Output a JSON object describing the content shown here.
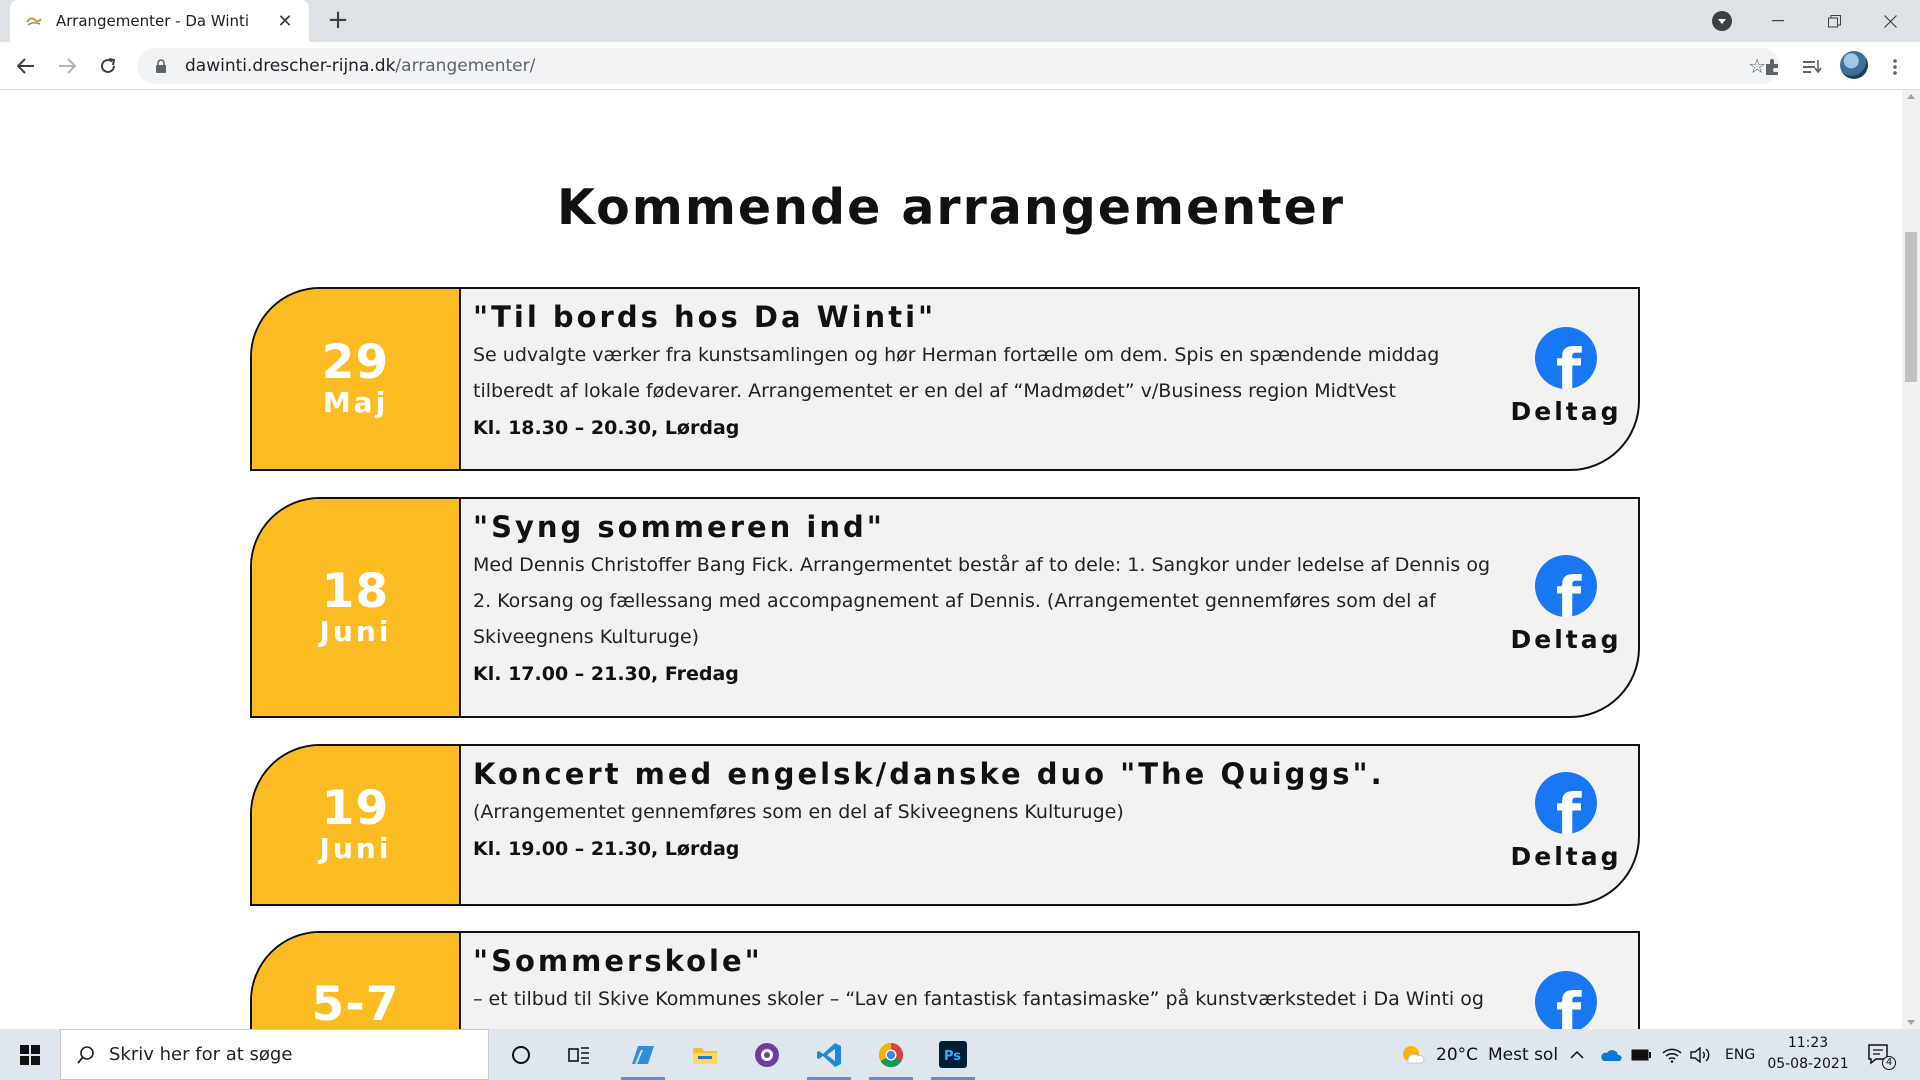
{
  "browser": {
    "tab_title": "Arrangementer - Da Winti",
    "tab_close": "✕",
    "new_tab": "+",
    "url_domain": "dawinti.drescher-rijna.dk",
    "url_path": "/arrangementer/"
  },
  "page": {
    "heading": "Kommende arrangementer",
    "deltag_label": "Deltag",
    "fb_glyph": "f",
    "events": [
      {
        "day": "29",
        "month": "Maj",
        "title": "\"Til bords hos Da Winti\"",
        "description": "Se udvalgte værker fra kunstsamlingen og hør Herman fortælle om dem. Spis en spændende middag tilberedt af lokale fødevarer. Arrangementet er en del af “Madmødet” v/Business region MidtVest",
        "time": "Kl. 18.30 – 20.30, Lørdag"
      },
      {
        "day": "18",
        "month": "Juni",
        "title": "\"Syng sommeren ind\"",
        "description": "Med Dennis Christoffer Bang Fick. Arrangermentet består af to dele: 1. Sangkor under ledelse af Dennis og 2. Korsang og fællessang med accompagnement af Dennis. (Arrangementet gennemføres som del af Skiveegnens Kulturuge)",
        "time": "Kl. 17.00 – 21.30, Fredag"
      },
      {
        "day": "19",
        "month": "Juni",
        "title": "Koncert med engelsk/danske duo \"The Quiggs\".",
        "description": "(Arrangementet gennemføres som en del af Skiveegnens Kulturuge)",
        "time": "Kl. 19.00 – 21.30, Lørdag"
      },
      {
        "day": "5-7",
        "month": "",
        "title": "\"Sommerskole\"",
        "description": "– et tilbud til Skive Kommunes skoler – “Lav en fantastisk fantasimaske” på kunstværkstedet i Da Winti og",
        "time": ""
      }
    ]
  },
  "taskbar": {
    "search_placeholder": "Skriv her for at søge",
    "weather_temp": "20°C",
    "weather_text": "Mest sol",
    "language": "ENG",
    "time": "11:23",
    "date": "05-08-2021",
    "notification_count": "4"
  },
  "colors": {
    "date_box": "#fbbb22",
    "facebook": "#1877f2",
    "card_bg": "#f2f2f2"
  }
}
